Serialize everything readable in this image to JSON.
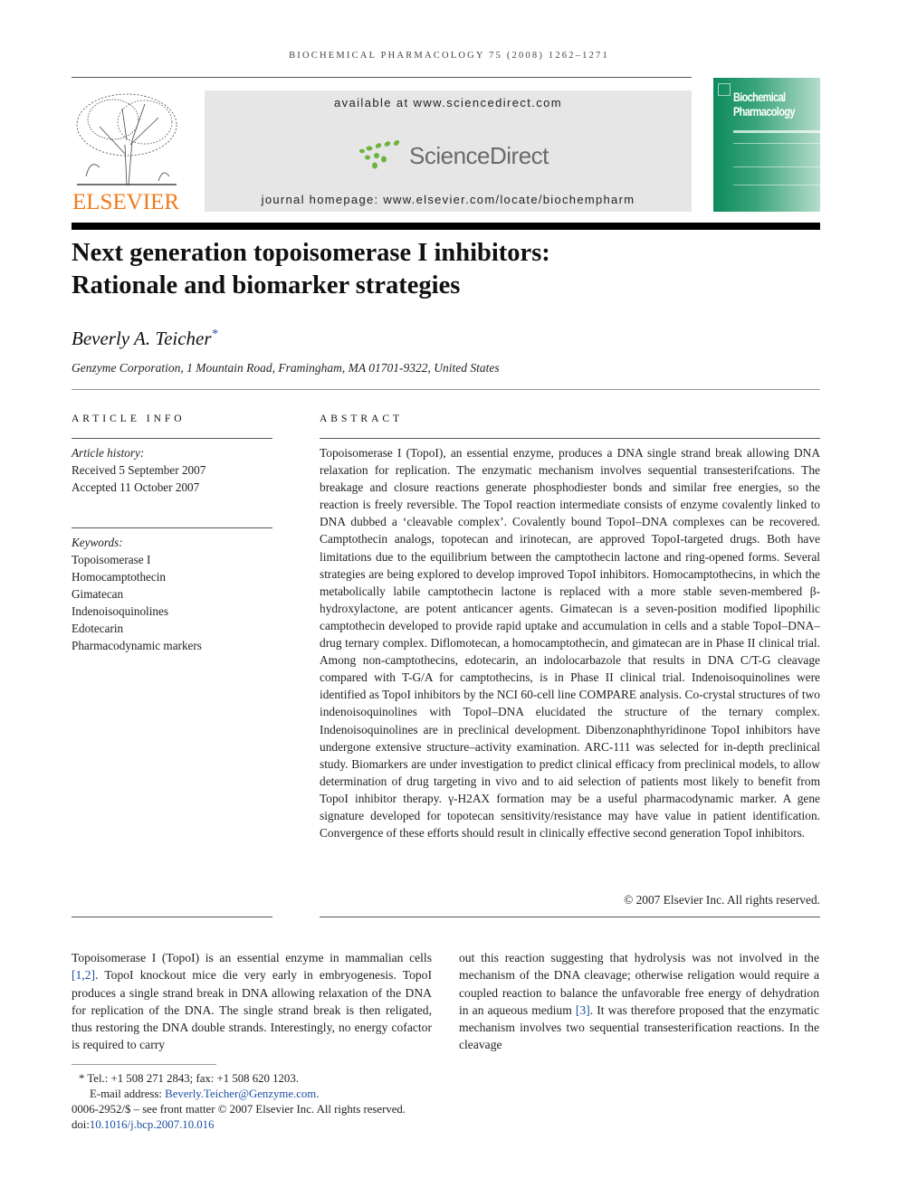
{
  "header": {
    "running_head": "BIOCHEMICAL PHARMACOLOGY 75 (2008) 1262–1271",
    "publisher_logo_text": "ELSEVIER",
    "available_at": "available at www.sciencedirect.com",
    "sciencedirect_logo_text": "ScienceDirect",
    "journal_homepage": "journal homepage: www.elsevier.com/locate/biochempharm",
    "cover_title": [
      "Biochemical",
      "Pharmacology"
    ],
    "colors": {
      "elsevier_orange": "#f07b1d",
      "sciencedirect_green": "#6cb33e",
      "cover_green": "#0d8a5c",
      "link_blue": "#1a4fa0"
    }
  },
  "article": {
    "title_line1": "Next generation topoisomerase I inhibitors:",
    "title_line2": "Rationale and biomarker strategies",
    "author": "Beverly A. Teicher",
    "author_mark": "*",
    "affiliation": "Genzyme Corporation, 1 Mountain Road, Framingham, MA 01701-9322, United States"
  },
  "article_info": {
    "heading": "ARTICLE INFO",
    "history_label": "Article history:",
    "received": "Received 5 September 2007",
    "accepted": "Accepted 11 October 2007",
    "keywords_label": "Keywords:",
    "keywords": [
      "Topoisomerase I",
      "Homocamptothecin",
      "Gimatecan",
      "Indenoisoquinolines",
      "Edotecarin",
      "Pharmacodynamic markers"
    ]
  },
  "abstract": {
    "heading": "ABSTRACT",
    "text": "Topoisomerase I (TopoI), an essential enzyme, produces a DNA single strand break allowing DNA relaxation for replication. The enzymatic mechanism involves sequential transesterifcations. The breakage and closure reactions generate phosphodiester bonds and similar free energies, so the reaction is freely reversible. The TopoI reaction intermediate consists of enzyme covalently linked to DNA dubbed a ‘cleavable complex’. Covalently bound TopoI–DNA complexes can be recovered. Camptothecin analogs, topotecan and irinotecan, are approved TopoI-targeted drugs. Both have limitations due to the equilibrium between the camptothecin lactone and ring-opened forms. Several strategies are being explored to develop improved TopoI inhibitors. Homocamptothecins, in which the metabolically labile camptothecin lactone is replaced with a more stable seven-membered β-hydroxylactone, are potent anticancer agents. Gimatecan is a seven-position modified lipophilic camptothecin developed to provide rapid uptake and accumulation in cells and a stable TopoI–DNA–drug ternary complex. Diflomotecan, a homocamptothecin, and gimatecan are in Phase II clinical trial. Among non-camptothecins, edotecarin, an indolocarbazole that results in DNA C/T-G cleavage compared with T-G/A for camptothecins, is in Phase II clinical trial. Indenoisoquinolines were identified as TopoI inhibitors by the NCI 60-cell line COMPARE analysis. Co-crystal structures of two indenoisoquinolines with TopoI–DNA elucidated the structure of the ternary complex. Indenoisoquinolines are in preclinical development. Dibenzonaphthyridinone TopoI inhibitors have undergone extensive structure–activity examination. ARC-111 was selected for in-depth preclinical study. Biomarkers are under investigation to predict clinical efficacy from preclinical models, to allow determination of drug targeting in vivo and to aid selection of patients most likely to benefit from TopoI inhibitor therapy. γ-H2AX formation may be a useful pharmacodynamic marker. A gene signature developed for topotecan sensitivity/resistance may have value in patient identification. Convergence of these efforts should result in clinically effective second generation TopoI inhibitors.",
    "copyright": "© 2007 Elsevier Inc. All rights reserved."
  },
  "body": {
    "left": {
      "p1": "Topoisomerase I (TopoI) is an essential enzyme in mammalian cells ",
      "ref1": "[1,2]",
      "p2": ". TopoI knockout mice die very early in embryogenesis. TopoI produces a single strand break in DNA allowing relaxation of the DNA for replication of the DNA. The single strand break is then religated, thus restoring the DNA double strands. Interestingly, no energy cofactor is required to carry"
    },
    "right": {
      "p1": "out this reaction suggesting that hydrolysis was not involved in the mechanism of the DNA cleavage; otherwise religation would require a coupled reaction to balance the unfavorable free energy of dehydration in an aqueous medium ",
      "ref1": "[3]",
      "p2": ". It was therefore proposed that the enzymatic mechanism involves two sequential transesterification reactions. In the cleavage"
    }
  },
  "footnotes": {
    "mark": "*",
    "contact": "Tel.: +1 508 271 2843; fax: +1 508 620 1203.",
    "email_label": "E-mail address: ",
    "email": "Beverly.Teicher@Genzyme.com",
    "email_end": ".",
    "issn": "0006-2952/$ – see front matter © 2007 Elsevier Inc. All rights reserved.",
    "doi_label": "doi:",
    "doi": "10.1016/j.bcp.2007.10.016"
  }
}
